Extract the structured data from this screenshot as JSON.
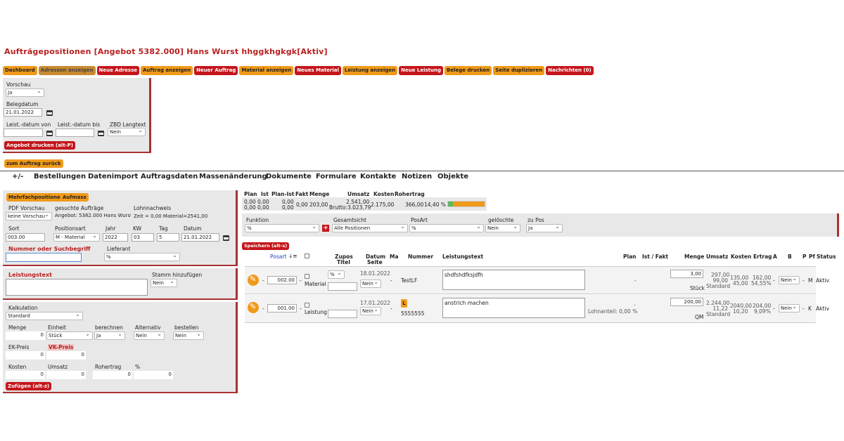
{
  "page_title": "Aufträgepositionen [Angebot 5382.000] Hans Wurst hhggkhgkgk[Aktiv]",
  "top_buttons": [
    {
      "label": "Dashboard",
      "style": "o"
    },
    {
      "label": "Adressen anzeigen",
      "style": "g"
    },
    {
      "label": "Neue Adresse",
      "style": "r"
    },
    {
      "label": "Auftrag anzeigen",
      "style": "o"
    },
    {
      "label": "Neuer Auftrag",
      "style": "r"
    },
    {
      "label": "Material anzeigen",
      "style": "o"
    },
    {
      "label": "Neues Material",
      "style": "r"
    },
    {
      "label": "Leistung anzeigen",
      "style": "o"
    },
    {
      "label": "Neue Leistung",
      "style": "r"
    },
    {
      "label": "Belege drucken",
      "style": "o"
    },
    {
      "label": "Seite duplizieren",
      "style": "o"
    },
    {
      "label": "Nachrichten (0)",
      "style": "r"
    }
  ],
  "print_panel": {
    "vorschau_label": "Vorschau",
    "vorschau_value": "Ja",
    "belegdatum_label": "Belegdatum",
    "belegdatum_value": "21.01.2022",
    "leist_von_label": "Leist.-datum von",
    "leist_bis_label": "Leist.-datum bis",
    "zbd_label": "ZBD Langtext",
    "zbd_value": "Nein",
    "print_button": "Angebot drucken (alt-P)"
  },
  "back_button": "zum Auftrag zurück",
  "nav_tabs": [
    "+/-",
    "Bestellungen",
    "Datenimport",
    "Auftragsdaten",
    "Massenänderung",
    "Dokumente",
    "Formulare",
    "Kontakte",
    "Notizen",
    "Objekte"
  ],
  "left_form": {
    "mehrfach_button": "Mehrfachpositionen",
    "aufmass_button": "Aufmass",
    "pdf_label": "PDF Vorschau",
    "pdf_value": "keine Vorschau",
    "gesucht_label": "gesuchte Aufträge",
    "gesucht_value": "Angebot: 5382.000 Hans Wurst",
    "lohn_label": "Lohnnachweis",
    "lohn_value": "Zeit = 0,00 Material=2541,00",
    "sort_label": "Sort",
    "sort_value": "003.00",
    "posart_label": "Positionsart",
    "posart_value": "M - Material",
    "jahr_label": "Jahr",
    "jahr_value": "2022",
    "kw_label": "KW",
    "kw_value": "03",
    "tag_label": "Tag",
    "tag_value": "5",
    "datum_label": "Datum",
    "datum_value": "21.01.2022",
    "nummer_label": "Nummer oder Suchbegriff",
    "lieferant_label": "Lieferant",
    "lieferant_value": "%",
    "leistungstext_label": "Leistungstext",
    "stamm_label": "Stamm hinzufügen",
    "stamm_value": "Nein",
    "kalk_label": "Kalkulation",
    "kalk_value": "Standard",
    "menge_label": "Menge",
    "menge_value": "0",
    "einheit_label": "Einheit",
    "einheit_value": "Stück",
    "berechnen_label": "berechnen",
    "berechnen_value": "Ja",
    "alternativ_label": "Alternativ",
    "alternativ_value": "Nein",
    "bestellen_label": "bestellen",
    "bestellen_value": "Nein",
    "ek_label": "EK-Preis",
    "ek_value": "0",
    "vk_label": "VK-Preis",
    "vk_value": "0",
    "kosten_label": "Kosten",
    "kosten_value": "0",
    "umsatz_label": "Umsatz",
    "umsatz_value": "0",
    "rohertrag_label": "Rohertrag",
    "rohertrag_value": "0",
    "prozent_label": "%",
    "prozent_value": "0",
    "add_button": "Zufügen (alt-z)"
  },
  "summary": {
    "headers": [
      "Plan",
      "Ist",
      "Plan-Ist",
      "Fakt",
      "Menge",
      "Umsatz",
      "Kosten",
      "Rohertrag"
    ],
    "plan": [
      "0,00",
      "0,00"
    ],
    "ist": [
      "0,00",
      "0,00"
    ],
    "plan_ist": [
      "0,00",
      "0,00"
    ],
    "fakt": "0,00",
    "menge": "203,00",
    "umsatz": "2.541,00",
    "brutto": "Brutto:3.023,79",
    "kosten": "2.175,00",
    "rohertrag": "366,00",
    "rohertrag_pct": "14,40 %",
    "progress_fraction": 0.14
  },
  "filter": {
    "funktion_label": "Funktion",
    "funktion_value": "%",
    "gesamtsicht_label": "Gesamtsicht",
    "gesamtsicht_value": "Alle Positionen",
    "posart_label": "PosArt",
    "posart_value": "%",
    "geloeschte_label": "gelöschte",
    "geloeschte_value": "Nein",
    "zupos_label": "zu Pos",
    "zupos_value": "Ja"
  },
  "save_button": "Speichern (alt-s)",
  "table": {
    "headers": {
      "posart": "Posart",
      "zupos": "Zupos",
      "titel": "Titel",
      "datum": "Datum",
      "seite": "Seite",
      "ma": "Ma",
      "nummer": "Nummer",
      "leistungstext": "Leistungstext",
      "plan": "Plan",
      "istfakt": "Ist / Fakt",
      "menge": "Menge",
      "umsatz": "Umsatz",
      "kosten": "Kosten",
      "ertrag": "Ertrag",
      "a": "A",
      "b": "B",
      "p": "P",
      "pf": "Pf",
      "status": "Status"
    },
    "rows": [
      {
        "dash": "-",
        "sort": "002.00",
        "art": "Material",
        "zupos": "%",
        "datum": "18.01.2022",
        "seite": "Nein",
        "ma": "-",
        "nummer": "TestLF",
        "text": "shdfshdfksjdfh",
        "plan": "-",
        "menge": "3,00",
        "einheit": "Stück",
        "umsatz1": "297,00",
        "umsatz2": "99,00",
        "umsatz3": "Standard",
        "kosten1": "135,00",
        "kosten2": "45,00",
        "ertrag1": "162,00",
        "ertrag2": "54,55%",
        "a": "-",
        "b": "Nein",
        "p": "-",
        "pf": "M",
        "status": "Aktiv"
      },
      {
        "dash": "-",
        "sort": "001.00",
        "art": "Leistung",
        "zupos": "",
        "datum": "17.01.2022",
        "seite": "Nein",
        "ma": "-",
        "badge": "L",
        "nummer": "5555555",
        "text": "anstrich machen",
        "plan": "Lohnanteil: 0,00 %",
        "plan_dash": "-",
        "menge": "200,00",
        "einheit": "QM",
        "umsatz1": "2.244,00",
        "umsatz2": "11,22",
        "umsatz3": "Standard",
        "kosten1": "2040,00",
        "kosten2": "10,20",
        "ertrag1": "204,00",
        "ertrag2": "9,09%",
        "a": "-",
        "b": "Nein",
        "p": "-",
        "pf": "K",
        "status": "Aktiv"
      }
    ]
  },
  "colors": {
    "accent_red": "#c4161c",
    "accent_orange": "#f09a1a",
    "title_red": "#b8201f",
    "progress_green": "#5cb85c"
  }
}
